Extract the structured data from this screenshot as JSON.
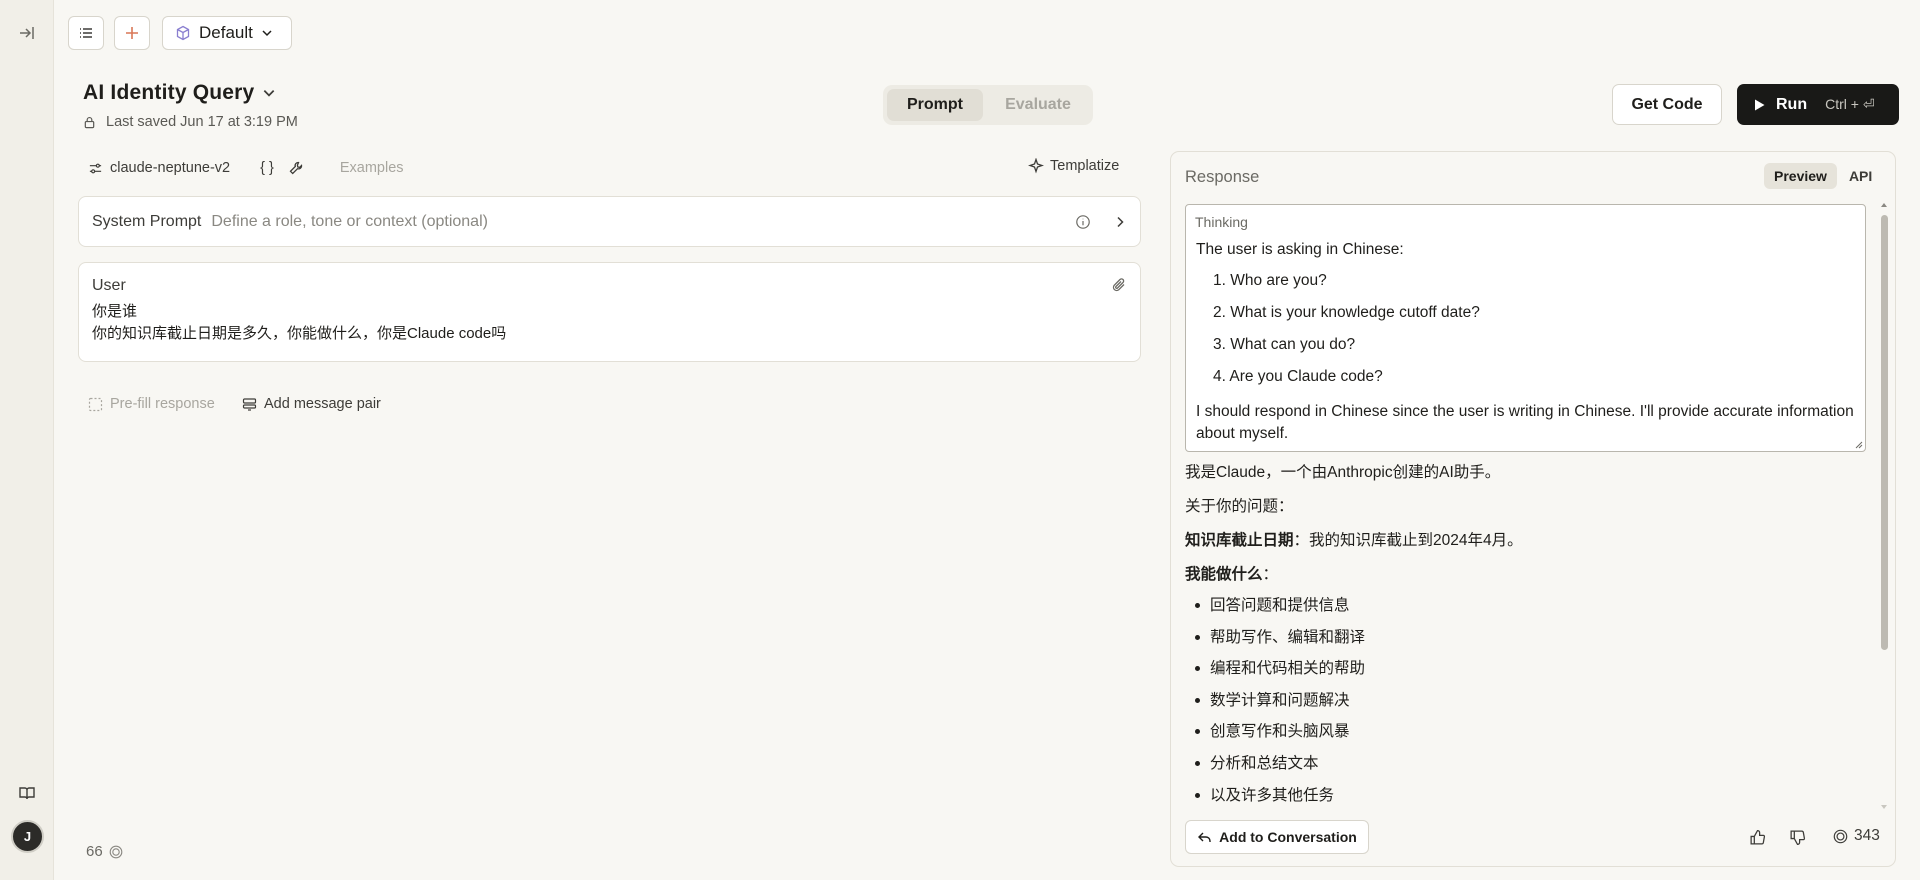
{
  "toolbar": {
    "preset": "Default"
  },
  "header": {
    "title": "AI Identity Query",
    "saved": "Last saved Jun 17 at 3:19 PM",
    "tabs": [
      {
        "label": "Prompt",
        "active": true
      },
      {
        "label": "Evaluate",
        "active": false
      }
    ],
    "get_code": "Get Code",
    "run": "Run",
    "run_shortcut": "Ctrl + ⏎"
  },
  "editor": {
    "model": "claude-neptune-v2",
    "variables_label": "{ }",
    "examples": "Examples",
    "templatize": "Templatize",
    "system_prompt": {
      "label": "System Prompt",
      "placeholder": "Define a role, tone or context (optional)"
    },
    "user": {
      "label": "User",
      "lines": [
        "你是谁",
        "你的知识库截止日期是多久，你能做什么，你是Claude code吗"
      ]
    },
    "prefill": "Pre-fill response",
    "add_pair": "Add message pair",
    "token_count": "66"
  },
  "response": {
    "label": "Response",
    "view_tabs": [
      "Preview",
      "API"
    ],
    "thinking": {
      "label": "Thinking",
      "intro": "The user is asking in Chinese:",
      "items": [
        "1. Who are you?",
        "2. What is your knowledge cutoff date?",
        "3. What can you do?",
        "4. Are you Claude code?"
      ],
      "conclusion": "I should respond in Chinese since the user is writing in Chinese. I'll provide accurate information about myself."
    },
    "answer": {
      "intro": "我是Claude，一个由Anthropic创建的AI助手。",
      "about": "关于你的问题：",
      "cutoff_label": "知识库截止日期",
      "cutoff_text": "：我的知识库截止到2024年4月。",
      "can_do_label": "我能做什么",
      "can_do_colon": "：",
      "bullets": [
        "回答问题和提供信息",
        "帮助写作、编辑和翻译",
        "编程和代码相关的帮助",
        "数学计算和问题解决",
        "创意写作和头脑风暴",
        "分析和总结文本",
        "以及许多其他任务"
      ]
    },
    "add_to_conversation": "Add to Conversation",
    "token_count": "343"
  },
  "colors": {
    "background": "#f8f7f3",
    "run_button": "#191917",
    "add_accent": "#d97757"
  }
}
